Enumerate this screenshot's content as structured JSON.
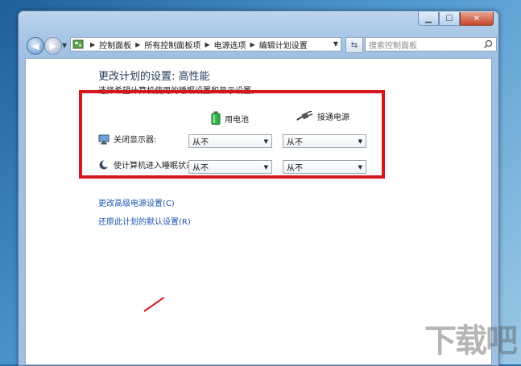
{
  "window": {
    "caption_buttons": {
      "minimize": "▁",
      "maximize": "☐",
      "close": "✕"
    }
  },
  "nav": {
    "breadcrumb": [
      "控制面板",
      "所有控制面板项",
      "电源选项",
      "编辑计划设置"
    ],
    "search_placeholder": "搜索控制面板"
  },
  "page": {
    "title": "更改计划的设置: 高性能",
    "subtitle": "选择希望计算机使用的睡眠设置和显示设置。",
    "columns": {
      "battery": "用电池",
      "plugged": "接通电源"
    },
    "settings": [
      {
        "label": "关闭显示器:",
        "battery_value": "从不",
        "plugged_value": "从不"
      },
      {
        "label": "使计算机进入睡眠状态:",
        "battery_value": "从不",
        "plugged_value": "从不"
      }
    ],
    "links": {
      "advanced": "更改高级电源设置(C)",
      "restore": "还原此计划的默认设置(R)"
    }
  },
  "watermark": "下载吧",
  "colors": {
    "highlight_box": "#d4171c",
    "link": "#1c54b3",
    "title": "#1e395b"
  }
}
